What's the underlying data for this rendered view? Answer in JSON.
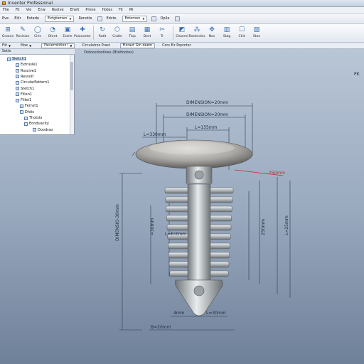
{
  "window": {
    "title": "Inventer Professional"
  },
  "menu": [
    "Flie",
    "Fit",
    "Vie",
    "Enw",
    "Roolve",
    "Ehelt",
    "Pmne",
    "Hotes",
    "Fit",
    "Mi"
  ],
  "quick": {
    "buttons": [
      "Eve",
      "Eilir",
      "Extede"
    ],
    "dropdown1": "Extgtomen",
    "button4": "Renotle",
    "button5": "Edcte",
    "dropdown2": "Fetomen",
    "button6": "Opile"
  },
  "ribbon": [
    {
      "label": "Groove",
      "icon": "sketch-icon",
      "glyph": "⊞"
    },
    {
      "label": "Revision",
      "icon": "revision-icon",
      "glyph": "✎"
    },
    {
      "label": "Cirlc",
      "icon": "circle-icon",
      "glyph": "◯"
    },
    {
      "label": "Ohret",
      "icon": "fillet-icon",
      "glyph": "◔"
    },
    {
      "label": "Extrie",
      "icon": "extrude-icon",
      "glyph": "▣"
    },
    {
      "label": "Poiocoetor",
      "icon": "point-icon",
      "glyph": "✚"
    },
    {
      "label": "Ratit",
      "icon": "rotate-icon",
      "glyph": "↻"
    },
    {
      "label": "Cralte",
      "icon": "create-icon",
      "glyph": "⬡"
    },
    {
      "label": "Tlop",
      "icon": "top-icon",
      "glyph": "▤"
    },
    {
      "label": "Dect",
      "icon": "detect-icon",
      "glyph": "▦"
    },
    {
      "label": "Tr",
      "icon": "trim-icon",
      "glyph": "✂"
    },
    {
      "label": "Chanrel",
      "icon": "chamfer-icon",
      "glyph": "◩"
    },
    {
      "label": "Roelontics",
      "icon": "pattern-icon",
      "glyph": "⁂"
    },
    {
      "label": "Nov",
      "icon": "move-icon",
      "glyph": "✥"
    },
    {
      "label": "Stag",
      "icon": "stage-icon",
      "glyph": "▥"
    },
    {
      "label": "Chit",
      "icon": "check-icon",
      "glyph": "☐"
    },
    {
      "label": "Stoe",
      "icon": "store-icon",
      "glyph": "▧"
    }
  ],
  "tabstrip": {
    "item1": "Fiit",
    "item2": "Moe",
    "box1": "Fieverrstition I",
    "box2": "Circulatros Prast",
    "box3": "Fioraxt Gm deem",
    "item3": "Cors Eir Peprnter"
  },
  "browser": {
    "header": "Sotts",
    "items": [
      "Sketch1",
      "Extrusle1",
      "Rsscive1",
      "Resvolt",
      "CircularPattern1",
      "Stetch1",
      "Fillen1",
      "Flilet1",
      "Fernst1",
      "Dhits",
      "Thotsts",
      "Eonduacity",
      "Doodrao"
    ]
  },
  "viewport": {
    "label": "Ootoosdostloes (Bfatfootos)",
    "viewcube": "PK",
    "dims": {
      "top1": "DIMENSION=20mm",
      "top2": "DIMENSION=20mm",
      "l_left": "L=330mm",
      "l_mid": "L=155mm",
      "red": "250mm",
      "side_left": "DIMENSIO-30mm",
      "inner_left": "=30mm",
      "inner_mid": "L=Entmm",
      "inner_right": "250mm",
      "right": "L=25mm",
      "bottom_in": "4mm",
      "bottom_in2": "L=30mm",
      "bottom": "B=20mm"
    }
  }
}
